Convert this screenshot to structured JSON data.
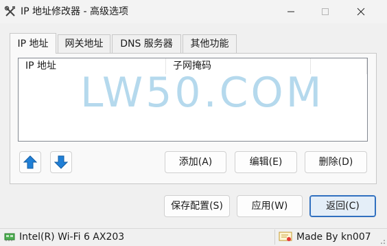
{
  "window": {
    "title": "IP 地址修改器 - 高级选项",
    "app_icon": "tools-icon"
  },
  "tabs": [
    {
      "label": "IP 地址",
      "active": true
    },
    {
      "label": "网关地址",
      "active": false
    },
    {
      "label": "DNS 服务器",
      "active": false
    },
    {
      "label": "其他功能",
      "active": false
    }
  ],
  "list": {
    "columns": [
      "IP 地址",
      "子网掩码",
      ""
    ],
    "rows": []
  },
  "watermark": "LW50.COM",
  "panel_buttons": {
    "up_icon": "arrow-up-icon",
    "down_icon": "arrow-down-icon",
    "add": "添加(A)",
    "edit": "编辑(E)",
    "delete": "删除(D)"
  },
  "footer_buttons": {
    "save": "保存配置(S)",
    "apply": "应用(W)",
    "back": "返回(C)"
  },
  "status": {
    "adapter": "Intel(R) Wi-Fi 6 AX203",
    "credit": "Made By kn007"
  },
  "colors": {
    "arrow_blue": "#1f7fd6",
    "watermark": "#a9d3ea",
    "primary_border": "#2f6fbf"
  }
}
